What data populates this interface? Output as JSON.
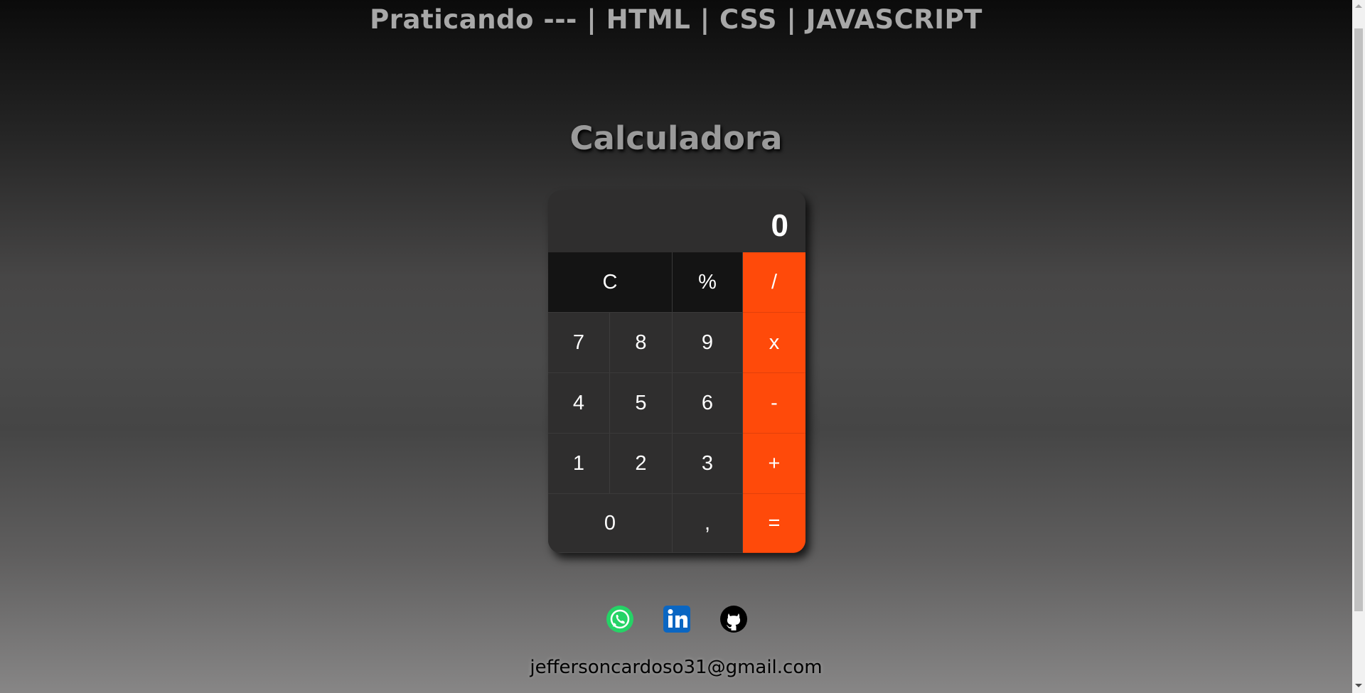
{
  "header": {
    "title": "Praticando --- | HTML | CSS | JAVASCRIPT"
  },
  "calculator": {
    "title": "Calculadora",
    "display": "0",
    "keys": {
      "clear": "C",
      "percent": "%",
      "divide": "/",
      "seven": "7",
      "eight": "8",
      "nine": "9",
      "multiply": "x",
      "four": "4",
      "five": "5",
      "six": "6",
      "subtract": "-",
      "one": "1",
      "two": "2",
      "three": "3",
      "add": "+",
      "zero": "0",
      "comma": ",",
      "equals": "="
    },
    "colors": {
      "operator": "#ff4a0a",
      "function": "#141414",
      "number": "#2f2e2e"
    }
  },
  "social": {
    "icons": [
      "whatsapp-icon",
      "linkedin-icon",
      "github-icon"
    ],
    "colors": {
      "whatsapp": "#25d366",
      "linkedin": "#0a66c2",
      "github": "#000000"
    }
  },
  "footer": {
    "email": "jeffersoncardoso31@gmail.com"
  }
}
